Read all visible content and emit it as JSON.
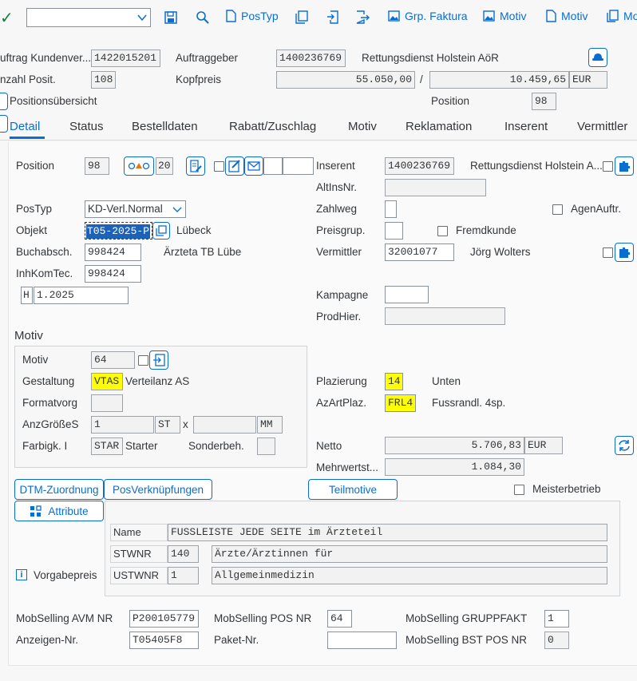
{
  "toolbar": {
    "dropdown_value": "",
    "postyp_label": "PosTyp",
    "grp_faktura_label": "Grp. Faktura",
    "motiv1_label": "Motiv",
    "motiv2_label": "Motiv",
    "mo_label": "Mo"
  },
  "header": {
    "auftrag_label": "uftrag Kundenver...",
    "auftrag_value": "1422015201",
    "auftraggeber_label": "Auftraggeber",
    "auftraggeber_value": "1400236769",
    "auftraggeber_name": "Rettungsdienst Holstein AöR",
    "anzahl_label": "nzahl Posit.",
    "anzahl_value": "108",
    "kopfpreis_label": "Kopfpreis",
    "kopfpreis_value": "55.050,00",
    "slash": "/",
    "kopfpreis_value2": "10.459,65",
    "currency": "EUR",
    "positionsuebersicht_label": "Positionsübersicht",
    "position_label": "Position",
    "position_value": "98"
  },
  "tabs": [
    "Detail",
    "Status",
    "Bestelldaten",
    "Rabatt/Zuschlag",
    "Motiv",
    "Reklamation",
    "Inserent",
    "Vermittler"
  ],
  "detail": {
    "position_label": "Position",
    "position_value": "98",
    "pos_counter": "20",
    "inserent_label": "Inserent",
    "inserent_value": "1400236769",
    "inserent_name": "Rettungsdienst Holstein A...",
    "altinsnr_label": "AltInsNr.",
    "altinsnr_value": "",
    "postyp_label": "PosTyp",
    "postyp_value": "KD-Verl.Normal",
    "zahlweg_label": "Zahlweg",
    "agenauftr_label": "AgenAuftr.",
    "objekt_label": "Objekt",
    "objekt_value": "T05-2025-P",
    "objekt_text": "Lübeck",
    "preisgrup_label": "Preisgrup.",
    "fremdkunde_label": "Fremdkunde",
    "buchabsch_label": "Buchabsch.",
    "buchabsch_value": "998424",
    "buchabsch_text": "Ärzteta TB Lübe",
    "vermittler_label": "Vermittler",
    "vermittler_value": "32001077",
    "vermittler_name": "Jörg Wolters",
    "inhkomtec_label": "InhKomTec.",
    "inhkomtec_value": "998424",
    "h_value": "H",
    "period_value": "1.2025",
    "kampagne_label": "Kampagne",
    "prodhier_label": "ProdHier."
  },
  "motiv": {
    "title": "Motiv",
    "motiv_label": "Motiv",
    "motiv_value": "64",
    "gestaltung_label": "Gestaltung",
    "gestaltung_value": "VTAS",
    "gestaltung_text": "Verteilanz AS",
    "formatvorg_label": "Formatvorg",
    "anzgroesse_label": "AnzGrößeS",
    "anzgroesse_value": "1",
    "st_value": "ST",
    "x_sep": "x",
    "mm_value": "MM",
    "farbigk_label": "Farbigk. I",
    "farbigk_value": "STAR",
    "farbigk_text": "Starter",
    "sonderbeh_label": "Sonderbeh.",
    "plazierung_label": "Plazierung",
    "plazierung_value": "14",
    "plazierung_text": "Unten",
    "azartplaz_label": "AzArtPlaz.",
    "azartplaz_value": "FRL4",
    "azartplaz_text": "Fussrandl. 4sp.",
    "netto_label": "Netto",
    "netto_value": "5.706,83",
    "netto_currency": "EUR",
    "mwst_label": "Mehrwertst...",
    "mwst_value": "1.084,30"
  },
  "buttons": {
    "dtm": "DTM-Zuordnung",
    "posverk": "PosVerknüpfungen",
    "teilmotive": "Teilmotive",
    "meisterbetrieb": "Meisterbetrieb",
    "attribute": "Attribute"
  },
  "attrs": {
    "name_label": "Name",
    "name_value": "FUSSLEISTE JEDE SEITE im Ärzteteil",
    "stwnr_label": "STWNR",
    "stwnr_value": "140",
    "stwnr_text": "Ärzte/Ärztinnen für",
    "ustwnr_label": "USTWNR",
    "ustwnr_value": "1",
    "ustwnr_text": "Allgemeinmedizin",
    "vorgabepreis_label": "Vorgabepreis"
  },
  "footer": {
    "avm_label": "MobSelling AVM NR",
    "avm_value": "P200105779",
    "pos_label": "MobSelling POS NR",
    "pos_value": "64",
    "gruppfakt_label": "MobSelling GRUPPFAKT",
    "gruppfakt_value": "1",
    "anzeigen_label": "Anzeigen-Nr.",
    "anzeigen_value": "T05405F8",
    "paket_label": "Paket-Nr.",
    "paket_value": "",
    "bstpos_label": "MobSelling BST POS NR",
    "bstpos_value": "0"
  },
  "colors": {
    "accent": "#0a6ed1",
    "highlight": "#ffff00",
    "ok": "#107e3e"
  }
}
